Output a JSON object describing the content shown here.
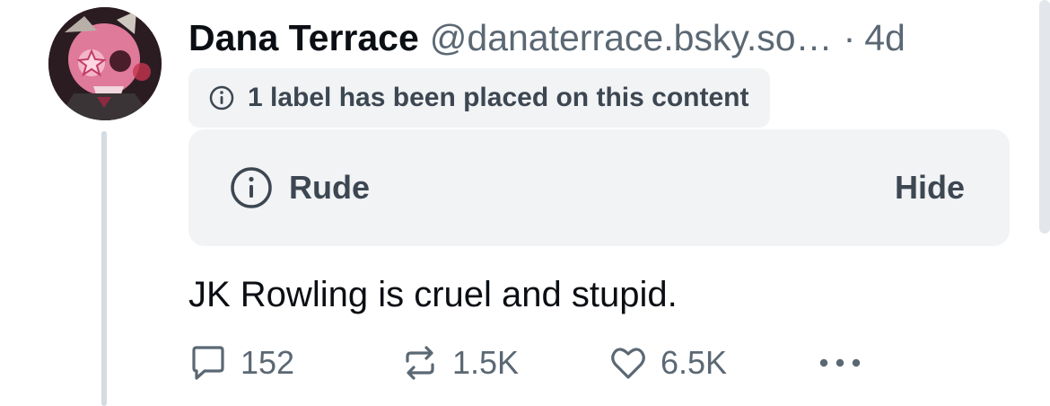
{
  "post": {
    "author": {
      "name": "Dana Terrace",
      "handle": "@danaterrace.bsky.so…",
      "separator": "·",
      "timestamp": "4d",
      "avatar_icon": "skull-avatar-icon"
    },
    "label_notice": {
      "icon": "info-icon",
      "text": "1 label has been placed on this content"
    },
    "content_warning": {
      "icon": "info-icon",
      "label": "Rude",
      "hide_label": "Hide"
    },
    "text": "JK Rowling is cruel and stupid.",
    "actions": {
      "reply_count": "152",
      "repost_count": "1.5K",
      "like_count": "6.5K",
      "reply_icon": "reply-icon",
      "repost_icon": "repost-icon",
      "like_icon": "heart-icon",
      "more_icon": "more-icon"
    }
  },
  "colors": {
    "text_primary": "#0b0f14",
    "text_secondary": "#5b6874",
    "label_text": "#3d4752",
    "panel_background": "#f1f3f5",
    "thread_line": "#d4dbe2"
  }
}
